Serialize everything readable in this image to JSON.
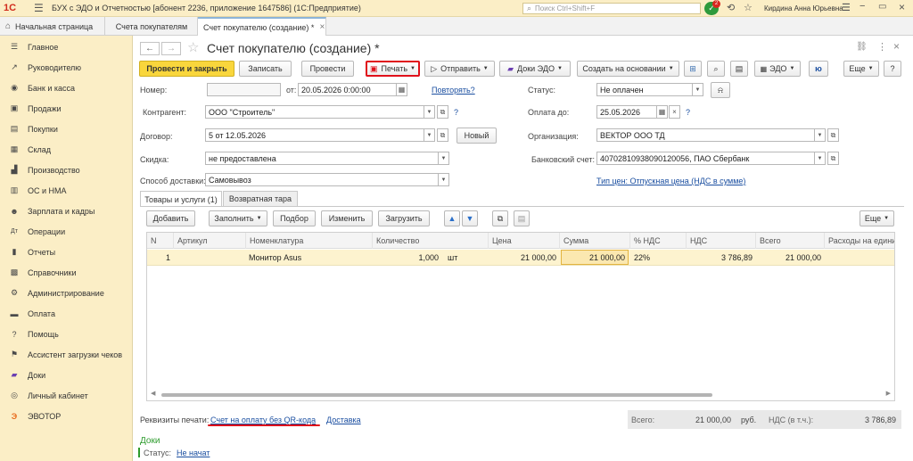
{
  "titlebar": {
    "logo": "1С",
    "title": "БУХ с ЭДО и Отчетностью [абонент 2236, приложение 1647586]  (1С:Предприятие)",
    "search_placeholder": "Поиск Ctrl+Shift+F",
    "notification_count": "2",
    "user": "Кирдина Анна Юрьевна"
  },
  "tabs": {
    "home": "Начальная страница",
    "items": [
      "Счета покупателям",
      "Счет покупателю (создание) *"
    ]
  },
  "sidebar": {
    "items": [
      {
        "label": "Главное",
        "icon": "☰"
      },
      {
        "label": "Руководителю",
        "icon": "↗"
      },
      {
        "label": "Банк и касса",
        "icon": "◉"
      },
      {
        "label": "Продажи",
        "icon": "▣"
      },
      {
        "label": "Покупки",
        "icon": "▤"
      },
      {
        "label": "Склад",
        "icon": "▦"
      },
      {
        "label": "Производство",
        "icon": "▟"
      },
      {
        "label": "ОС и НМА",
        "icon": "▥"
      },
      {
        "label": "Зарплата и кадры",
        "icon": "☻"
      },
      {
        "label": "Операции",
        "icon": "Дт"
      },
      {
        "label": "Отчеты",
        "icon": "▮"
      },
      {
        "label": "Справочники",
        "icon": "▩"
      },
      {
        "label": "Администрирование",
        "icon": "⚙"
      },
      {
        "label": "Оплата",
        "icon": "▬"
      },
      {
        "label": "Помощь",
        "icon": "?"
      },
      {
        "label": "Ассистент загрузки чеков",
        "icon": "⚑"
      },
      {
        "label": "Доки",
        "icon": "▰"
      },
      {
        "label": "Личный кабинет",
        "icon": "◎"
      },
      {
        "label": "ЭВОТОР",
        "icon": "Э"
      }
    ]
  },
  "form": {
    "title": "Счет покупателю (создание) *",
    "toolbar": {
      "post_close": "Провести и закрыть",
      "save": "Записать",
      "post": "Провести",
      "print": "Печать",
      "send": "Отправить",
      "docs_edo": "Доки ЭДО",
      "create_based": "Создать на основании",
      "edo": "ЭДО",
      "more": "Еще",
      "help": "?"
    },
    "fields": {
      "number_label": "Номер:",
      "number": "",
      "date_label": "от:",
      "date": "20.05.2026  0:00:00",
      "repeat": "Повторять?",
      "status_label": "Статус:",
      "status": "Не оплачен",
      "counterparty_label": "Контрагент:",
      "counterparty": "ООО \"Строитель\"",
      "pay_until_label": "Оплата до:",
      "pay_until": "25.05.2026",
      "contract_label": "Договор:",
      "contract": "5 от 12.05.2026",
      "new_button": "Новый",
      "org_label": "Организация:",
      "org": "ВЕКТОР ООО ТД",
      "discount_label": "Скидка:",
      "discount": "не предоставлена",
      "bank_label": "Банковский счет:",
      "bank": "40702810938090120056, ПАО Сбербанк",
      "delivery_label": "Способ доставки:",
      "delivery": "Самовывоз",
      "price_type": "Тип цен: Отпускная цена (НДС в сумме)"
    },
    "subtabs": [
      "Товары и услуги (1)",
      "Возвратная тара"
    ],
    "table_toolbar": {
      "add": "Добавить",
      "fill": "Заполнить",
      "select": "Подбор",
      "change": "Изменить",
      "load": "Загрузить",
      "more": "Еще"
    },
    "table": {
      "columns": [
        "N",
        "Артикул",
        "Номенклатура",
        "Количество",
        "Цена",
        "Сумма",
        "% НДС",
        "НДС",
        "Всего",
        "Расходы на едини"
      ],
      "rows": [
        {
          "n": "1",
          "article": "",
          "item": "Монитор Asus",
          "qty": "1,000",
          "unit": "шт",
          "price": "21 000,00",
          "sum": "21 000,00",
          "vat_rate": "22%",
          "vat": "3 786,89",
          "total": "21 000,00",
          "expenses": ""
        }
      ]
    },
    "footer": {
      "print_props_label": "Реквизиты печати:",
      "print_link": "Счет на оплату без QR-кода",
      "delivery_link": "Доставка",
      "total_label": "Всего:",
      "total_value": "21 000,00",
      "currency": "руб.",
      "vat_label": "НДС (в т.ч.):",
      "vat_value": "3 786,89",
      "docs_title": "Доки",
      "docs_status_label": "Статус:",
      "docs_status": "Не начат"
    }
  },
  "colors": {
    "accent_yellow": "#f9d63c",
    "highlight_red": "#e0101a",
    "link_blue": "#1a4ea0",
    "row_selected": "#fdf3cf",
    "docs_green": "#2d9b2d"
  }
}
